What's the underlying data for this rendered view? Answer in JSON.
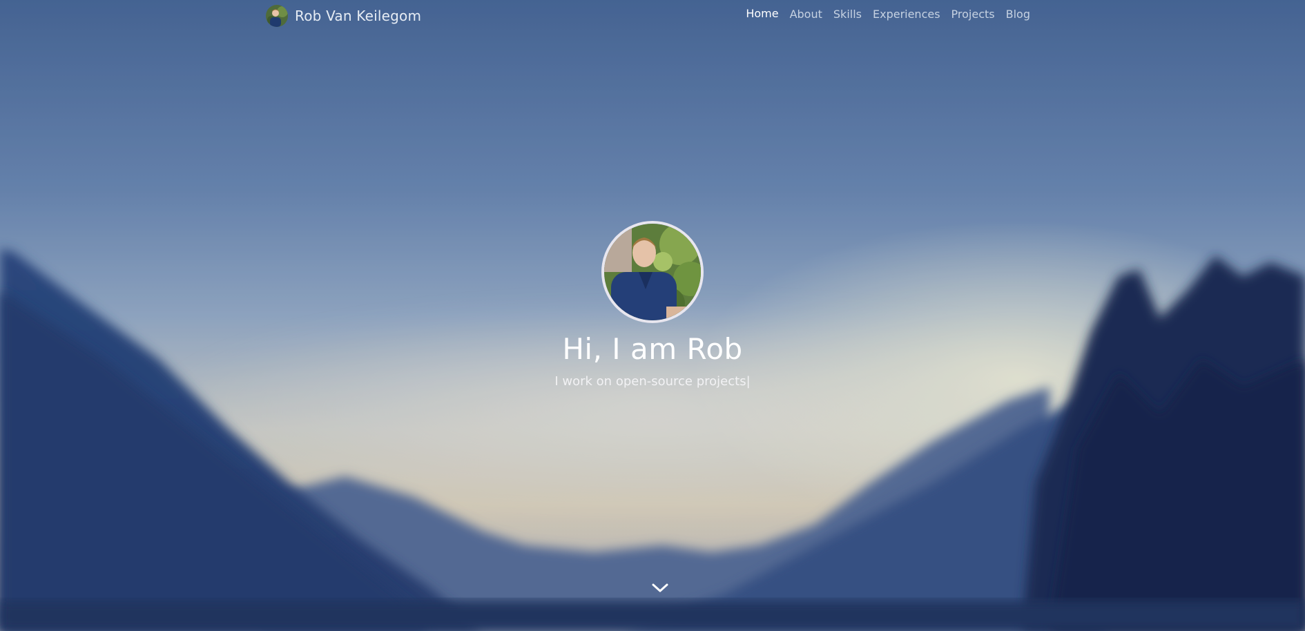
{
  "navbar": {
    "brand_name": "Rob Van Keilegom",
    "links": [
      {
        "label": "Home",
        "active": true
      },
      {
        "label": "About",
        "active": false
      },
      {
        "label": "Skills",
        "active": false
      },
      {
        "label": "Experiences",
        "active": false
      },
      {
        "label": "Projects",
        "active": false
      },
      {
        "label": "Blog",
        "active": false
      }
    ]
  },
  "hero": {
    "greeting": "Hi, I am Rob",
    "tagline": "I work on open-source projects|",
    "scroll_icon": "chevron-down-icon"
  },
  "colors": {
    "sky_top": "#4d6c9c",
    "sky_mid": "#8aa4c4",
    "cloud": "#f2eee2",
    "mountain": "#2f4a80",
    "tree": "#1b2c52",
    "text": "#ffffff"
  }
}
